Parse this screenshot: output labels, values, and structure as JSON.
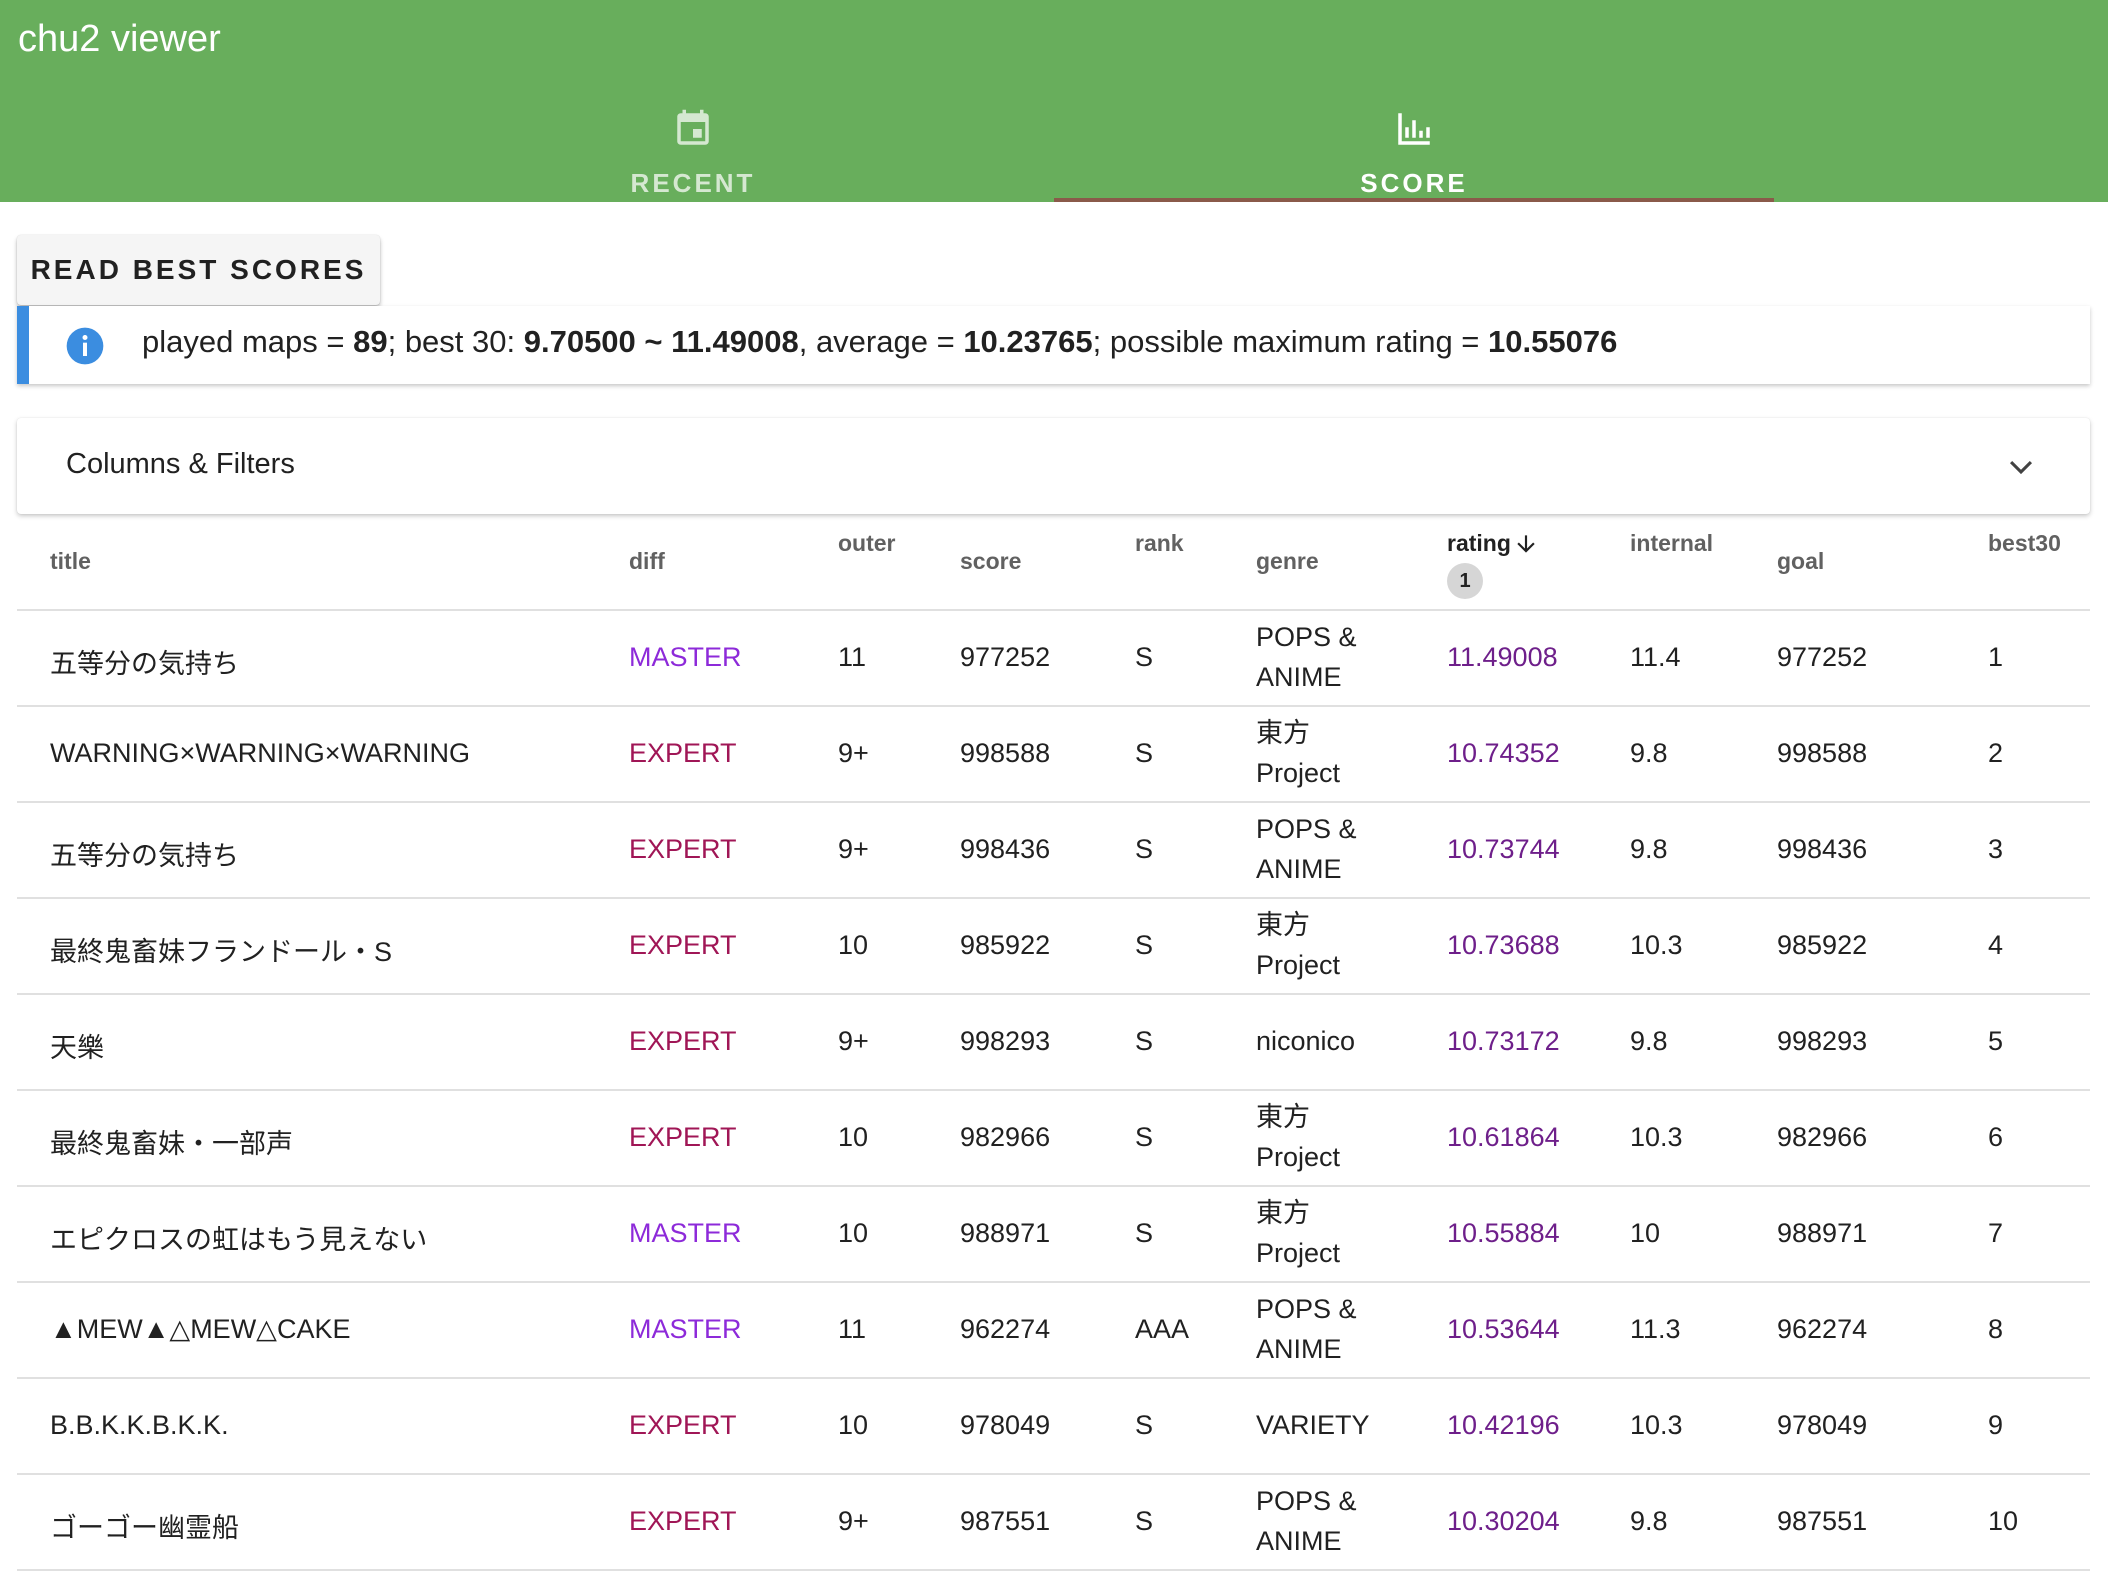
{
  "app": {
    "title": "chu2 viewer"
  },
  "tabs": [
    {
      "label": "RECENT",
      "icon": "calendar-icon",
      "active": false
    },
    {
      "label": "SCORE",
      "icon": "bar-chart-icon",
      "active": true
    }
  ],
  "colors": {
    "appbar": "#68ae5c",
    "master": "#8d2ad9",
    "expert": "#a01656",
    "rating": "#6e1f8a",
    "info": "#3b8de0"
  },
  "actions": {
    "read_best_scores": "READ BEST SCORES"
  },
  "summary": {
    "played_label": "played maps = ",
    "played_value": "89",
    "best30_label": "; best 30: ",
    "best30_range": "9.70500 ~ 11.49008",
    "average_label": ", average = ",
    "average_value": "10.23765",
    "max_label": "; possible maximum rating = ",
    "max_value": "10.55076"
  },
  "filters": {
    "title": "Columns & Filters",
    "expanded": false
  },
  "table": {
    "headers": {
      "title": "title",
      "diff": "diff",
      "outer": "outer",
      "score": "score",
      "rank": "rank",
      "genre": "genre",
      "rating": "rating",
      "internal": "internal",
      "goal": "goal",
      "best30": "best30"
    },
    "sort": {
      "column": "rating",
      "direction": "descending",
      "priority": "1"
    },
    "rows": [
      {
        "title": "五等分の気持ち",
        "diff": "MASTER",
        "outer": "11",
        "score": "977252",
        "rank": "S",
        "genre": "POPS & ANIME",
        "rating": "11.49008",
        "internal": "11.4",
        "goal": "977252",
        "best30": "1"
      },
      {
        "title": "WARNING×WARNING×WARNING",
        "diff": "EXPERT",
        "outer": "9+",
        "score": "998588",
        "rank": "S",
        "genre": "東方 Project",
        "rating": "10.74352",
        "internal": "9.8",
        "goal": "998588",
        "best30": "2"
      },
      {
        "title": "五等分の気持ち",
        "diff": "EXPERT",
        "outer": "9+",
        "score": "998436",
        "rank": "S",
        "genre": "POPS & ANIME",
        "rating": "10.73744",
        "internal": "9.8",
        "goal": "998436",
        "best30": "3"
      },
      {
        "title": "最終鬼畜妹フランドール・S",
        "diff": "EXPERT",
        "outer": "10",
        "score": "985922",
        "rank": "S",
        "genre": "東方 Project",
        "rating": "10.73688",
        "internal": "10.3",
        "goal": "985922",
        "best30": "4"
      },
      {
        "title": "天樂",
        "diff": "EXPERT",
        "outer": "9+",
        "score": "998293",
        "rank": "S",
        "genre": "niconico",
        "rating": "10.73172",
        "internal": "9.8",
        "goal": "998293",
        "best30": "5"
      },
      {
        "title": "最終鬼畜妹・一部声",
        "diff": "EXPERT",
        "outer": "10",
        "score": "982966",
        "rank": "S",
        "genre": "東方 Project",
        "rating": "10.61864",
        "internal": "10.3",
        "goal": "982966",
        "best30": "6"
      },
      {
        "title": "エピクロスの虹はもう見えない",
        "diff": "MASTER",
        "outer": "10",
        "score": "988971",
        "rank": "S",
        "genre": "東方 Project",
        "rating": "10.55884",
        "internal": "10",
        "goal": "988971",
        "best30": "7"
      },
      {
        "title": "▲MEW▲△MEW△CAKE",
        "diff": "MASTER",
        "outer": "11",
        "score": "962274",
        "rank": "AAA",
        "genre": "POPS & ANIME",
        "rating": "10.53644",
        "internal": "11.3",
        "goal": "962274",
        "best30": "8"
      },
      {
        "title": "B.B.K.K.B.K.K.",
        "diff": "EXPERT",
        "outer": "10",
        "score": "978049",
        "rank": "S",
        "genre": "VARIETY",
        "rating": "10.42196",
        "internal": "10.3",
        "goal": "978049",
        "best30": "9"
      },
      {
        "title": "ゴーゴー幽霊船",
        "diff": "EXPERT",
        "outer": "9+",
        "score": "987551",
        "rank": "S",
        "genre": "POPS & ANIME",
        "rating": "10.30204",
        "internal": "9.8",
        "goal": "987551",
        "best30": "10"
      }
    ]
  }
}
